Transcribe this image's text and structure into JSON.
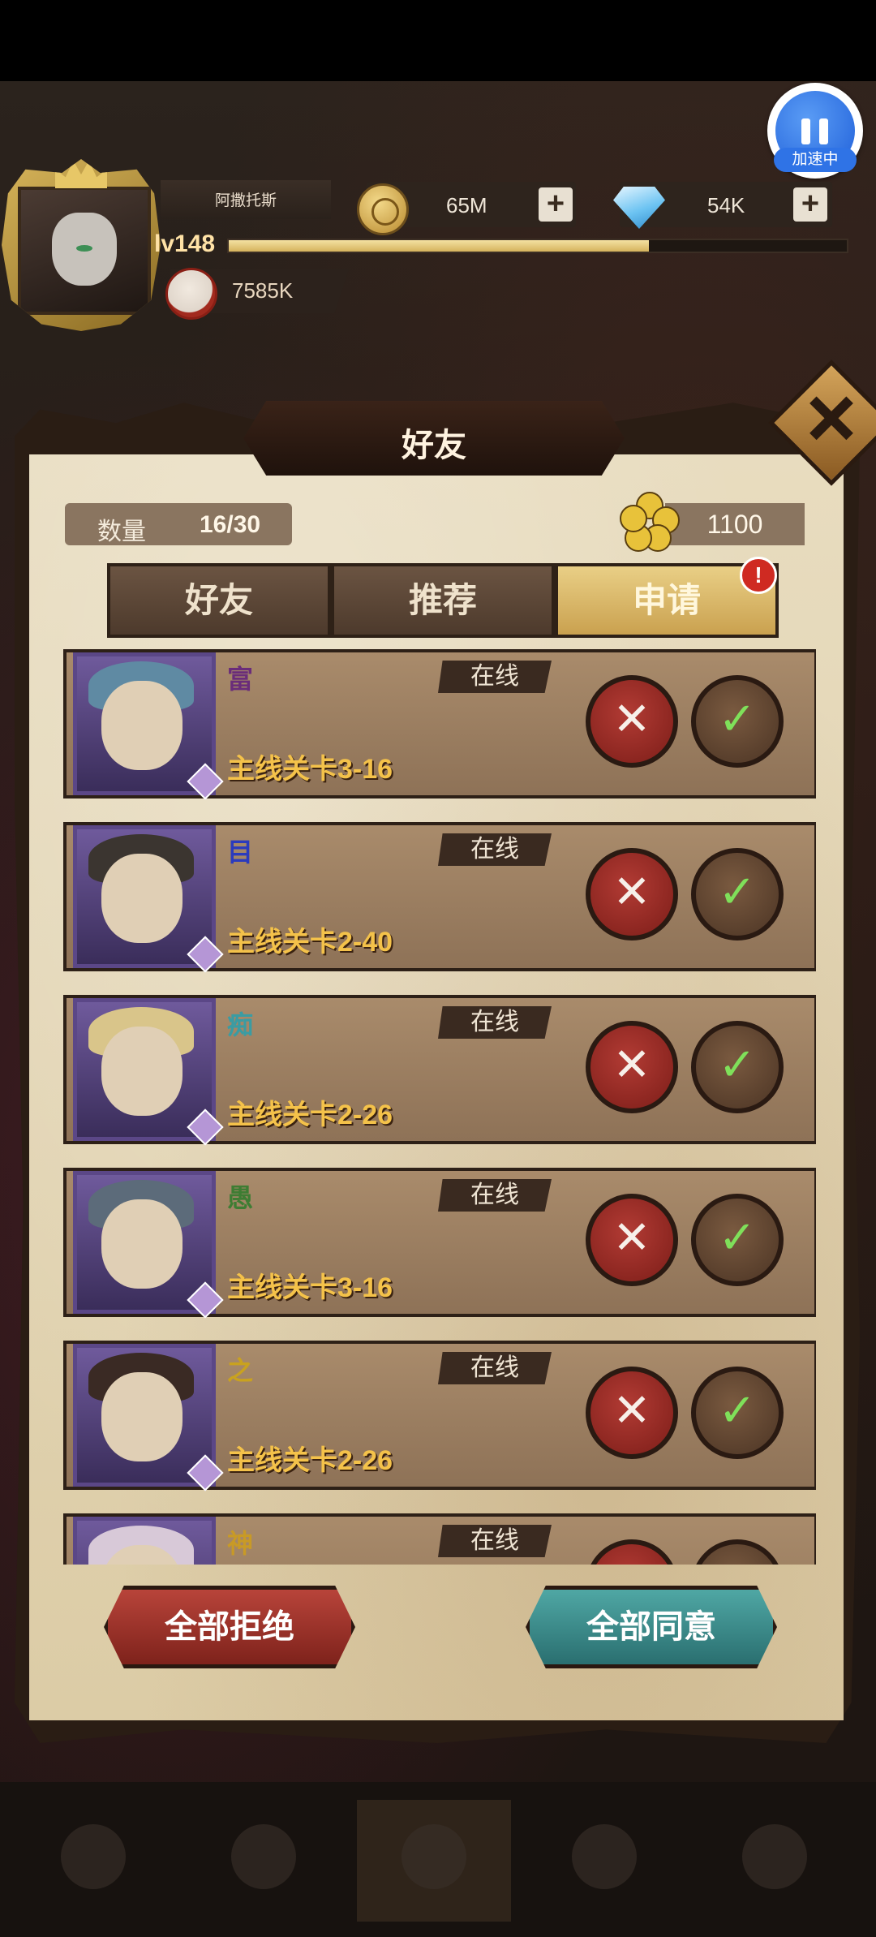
{
  "speed": {
    "label": "加速中"
  },
  "player": {
    "name": "阿撒托斯",
    "level": "lv148",
    "xp_fraction": 0.68,
    "power": "7585K"
  },
  "resources": {
    "coins": "65M",
    "diamonds": "54K"
  },
  "panel": {
    "title": "好友",
    "count_label": "数量",
    "count_value": "16/30",
    "flower_value": "1100"
  },
  "tabs": [
    {
      "label": "好友",
      "active": false
    },
    {
      "label": "推荐",
      "active": false
    },
    {
      "label": "申请",
      "active": true,
      "badge": "!"
    }
  ],
  "requests": [
    {
      "name": "富",
      "name_color": "#6a2c7a",
      "status": "在线",
      "stage": "主线关卡3-16"
    },
    {
      "name": "目",
      "name_color": "#2b3bbd",
      "status": "在线",
      "stage": "主线关卡2-40"
    },
    {
      "name": "痴",
      "name_color": "#3a9ca3",
      "status": "在线",
      "stage": "主线关卡2-26"
    },
    {
      "name": "愚",
      "name_color": "#3e7d33",
      "status": "在线",
      "stage": "主线关卡3-16"
    },
    {
      "name": "之",
      "name_color": "#c9a21f",
      "status": "在线",
      "stage": "主线关卡2-26"
    },
    {
      "name": "神",
      "name_color": "#c89a26",
      "status": "在线",
      "stage": ""
    }
  ],
  "actions": {
    "reject_all": "全部拒绝",
    "accept_all": "全部同意"
  },
  "icons": {
    "reject": "✕",
    "accept": "✓",
    "plus": "+"
  }
}
